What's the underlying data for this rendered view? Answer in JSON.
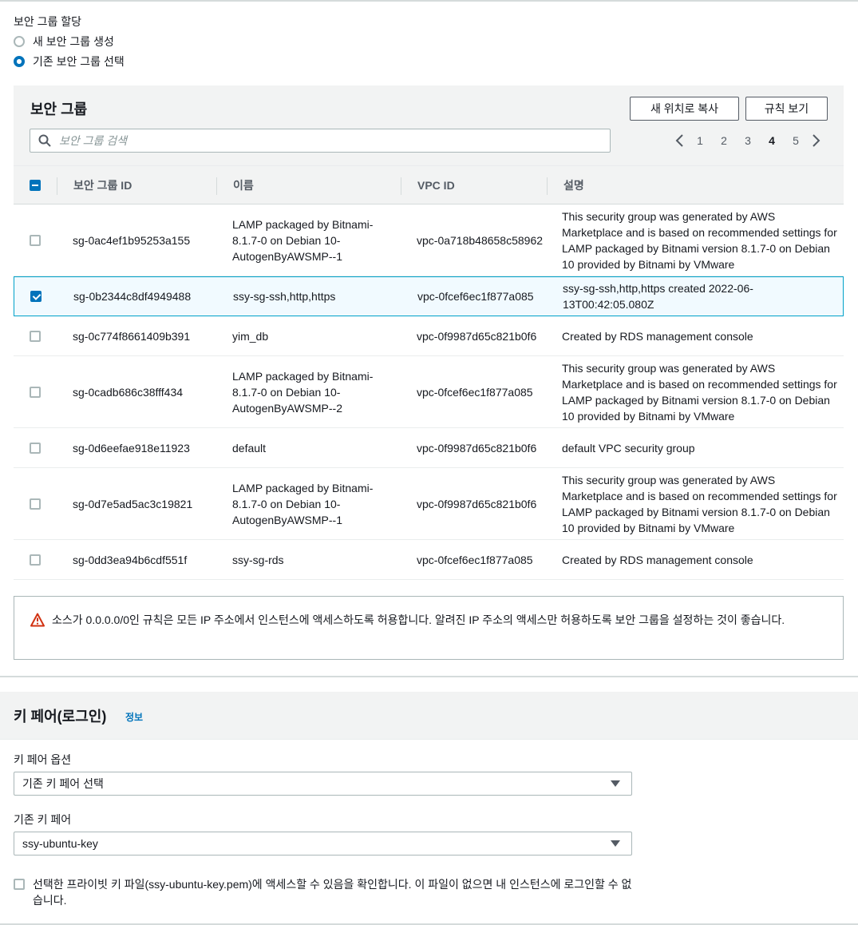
{
  "assignment": {
    "title": "보안 그룹 할당",
    "options": [
      {
        "label": "새 보안 그룹 생성",
        "selected": false
      },
      {
        "label": "기존 보안 그룹 선택",
        "selected": true
      }
    ]
  },
  "security_groups": {
    "title": "보안 그룹",
    "copy_button": "새 위치로 복사",
    "rules_button": "규칙 보기",
    "search_placeholder": "보안 그룹 검색",
    "pagination": {
      "pages": [
        "1",
        "2",
        "3",
        "4",
        "5"
      ],
      "current": "4"
    },
    "columns": [
      "보안 그룹 ID",
      "이름",
      "VPC ID",
      "설명"
    ],
    "rows": [
      {
        "id": "sg-0ac4ef1b95253a155",
        "name": "LAMP packaged by Bitnami-8.1.7-0 on Debian 10-AutogenByAWSMP--1",
        "vpc": "vpc-0a718b48658c58962",
        "desc": "This security group was generated by AWS Marketplace and is based on recommended settings for LAMP packaged by Bitnami version 8.1.7-0 on Debian 10 provided by Bitnami by VMware",
        "checked": false
      },
      {
        "id": "sg-0b2344c8df4949488",
        "name": "ssy-sg-ssh,http,https",
        "vpc": "vpc-0fcef6ec1f877a085",
        "desc": "ssy-sg-ssh,http,https created 2022-06-13T00:42:05.080Z",
        "checked": true
      },
      {
        "id": "sg-0c774f8661409b391",
        "name": "yim_db",
        "vpc": "vpc-0f9987d65c821b0f6",
        "desc": "Created by RDS management console",
        "checked": false
      },
      {
        "id": "sg-0cadb686c38fff434",
        "name": "LAMP packaged by Bitnami-8.1.7-0 on Debian 10-AutogenByAWSMP--2",
        "vpc": "vpc-0fcef6ec1f877a085",
        "desc": "This security group was generated by AWS Marketplace and is based on recommended settings for LAMP packaged by Bitnami version 8.1.7-0 on Debian 10 provided by Bitnami by VMware",
        "checked": false
      },
      {
        "id": "sg-0d6eefae918e11923",
        "name": "default",
        "vpc": "vpc-0f9987d65c821b0f6",
        "desc": "default VPC security group",
        "checked": false
      },
      {
        "id": "sg-0d7e5ad5ac3c19821",
        "name": "LAMP packaged by Bitnami-8.1.7-0 on Debian 10-AutogenByAWSMP--1",
        "vpc": "vpc-0f9987d65c821b0f6",
        "desc": "This security group was generated by AWS Marketplace and is based on recommended settings for LAMP packaged by Bitnami version 8.1.7-0 on Debian 10 provided by Bitnami by VMware",
        "checked": false
      },
      {
        "id": "sg-0dd3ea94b6cdf551f",
        "name": "ssy-sg-rds",
        "vpc": "vpc-0fcef6ec1f877a085",
        "desc": "Created by RDS management console",
        "checked": false
      }
    ],
    "warning": "소스가 0.0.0.0/0인 규칙은 모든 IP 주소에서 인스턴스에 액세스하도록 허용합니다. 알려진 IP 주소의 액세스만 허용하도록 보안 그룹을 설정하는 것이 좋습니다."
  },
  "key_pair": {
    "title": "키 페어(로그인)",
    "info_link": "정보",
    "option_label": "키 페어 옵션",
    "option_value": "기존 키 페어 선택",
    "existing_label": "기존 키 페어",
    "existing_value": "ssy-ubuntu-key",
    "ack_text": "선택한 프라이빗 키 파일(ssy-ubuntu-key.pem)에 액세스할 수 있음을 확인합니다. 이 파일이 없으면 내 인스턴스에 로그인할 수 없습니다.",
    "ack_checked": false
  },
  "colors": {
    "accent": "#0073bb",
    "selected_row_bg": "#f1faff",
    "selected_row_border": "#00a1c9",
    "warning": "#d13212"
  }
}
